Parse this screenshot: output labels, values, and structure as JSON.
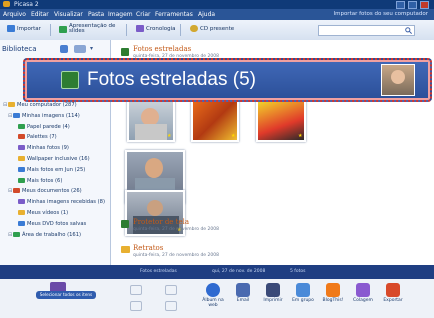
{
  "window": {
    "title": "Picasa 2"
  },
  "menu": {
    "items": [
      "Arquivo",
      "Editar",
      "Visualizar",
      "Pasta",
      "Imagem",
      "Criar",
      "Ferramentas",
      "Ajuda"
    ],
    "hint": "Importar fotos do seu computador"
  },
  "toolbar": {
    "importar": "Importar",
    "apresentacao": "Apresentação de slides",
    "cronologia": "Cronologia",
    "cd": "CD presente"
  },
  "sidebar": {
    "library_label": "Biblioteca",
    "items": [
      {
        "label": "Meu computador (287)",
        "indent": 0
      },
      {
        "label": "Minhas imagens (114)",
        "indent": 1
      },
      {
        "label": "Papel parede (4)",
        "indent": 2
      },
      {
        "label": "Palettes (7)",
        "indent": 2
      },
      {
        "label": "Minhas fotos (9)",
        "indent": 2
      },
      {
        "label": "Wallpaper inclusive (16)",
        "indent": 2
      },
      {
        "label": "Mais fotos em Jun (25)",
        "indent": 2
      },
      {
        "label": "Mais fotos (6)",
        "indent": 2
      },
      {
        "label": "Meus documentos (26)",
        "indent": 1
      },
      {
        "label": "Minhas imagens recebidas (8)",
        "indent": 2
      },
      {
        "label": "Meus vídeos (1)",
        "indent": 2
      },
      {
        "label": "Meus DVD fotos salvas",
        "indent": 2
      },
      {
        "label": "Área de trabalho (161)",
        "indent": 1
      }
    ]
  },
  "groups": [
    {
      "title": "Fotos estreladas",
      "date": "quinta-feira, 27 de novembro de 2008"
    },
    {
      "title": "Protetor de tela",
      "date": "quinta-feira, 27 de novembro de 2008"
    },
    {
      "title": "Retratos",
      "date": "quinta-feira, 27 de novembro de 2008"
    }
  ],
  "banner": {
    "label": "Fotos estreladas (5)"
  },
  "bluebar": {
    "left": "Fotos estreladas",
    "date": "qui, 27 de nov. de 2008",
    "count": "5 fotos"
  },
  "bottom": {
    "tray_label": "Selecionar todos os itens",
    "buttons": [
      "Álbum na web",
      "Email",
      "Imprimir",
      "Em grupo",
      "BlogThis!",
      "Colagem",
      "Exportar"
    ]
  },
  "colors": {
    "titlebar": "#0f3a78",
    "menubar": "#2a5597",
    "banner": "#3a5fae",
    "banner_border": "#d8342a",
    "group_title": "#c35a18"
  }
}
